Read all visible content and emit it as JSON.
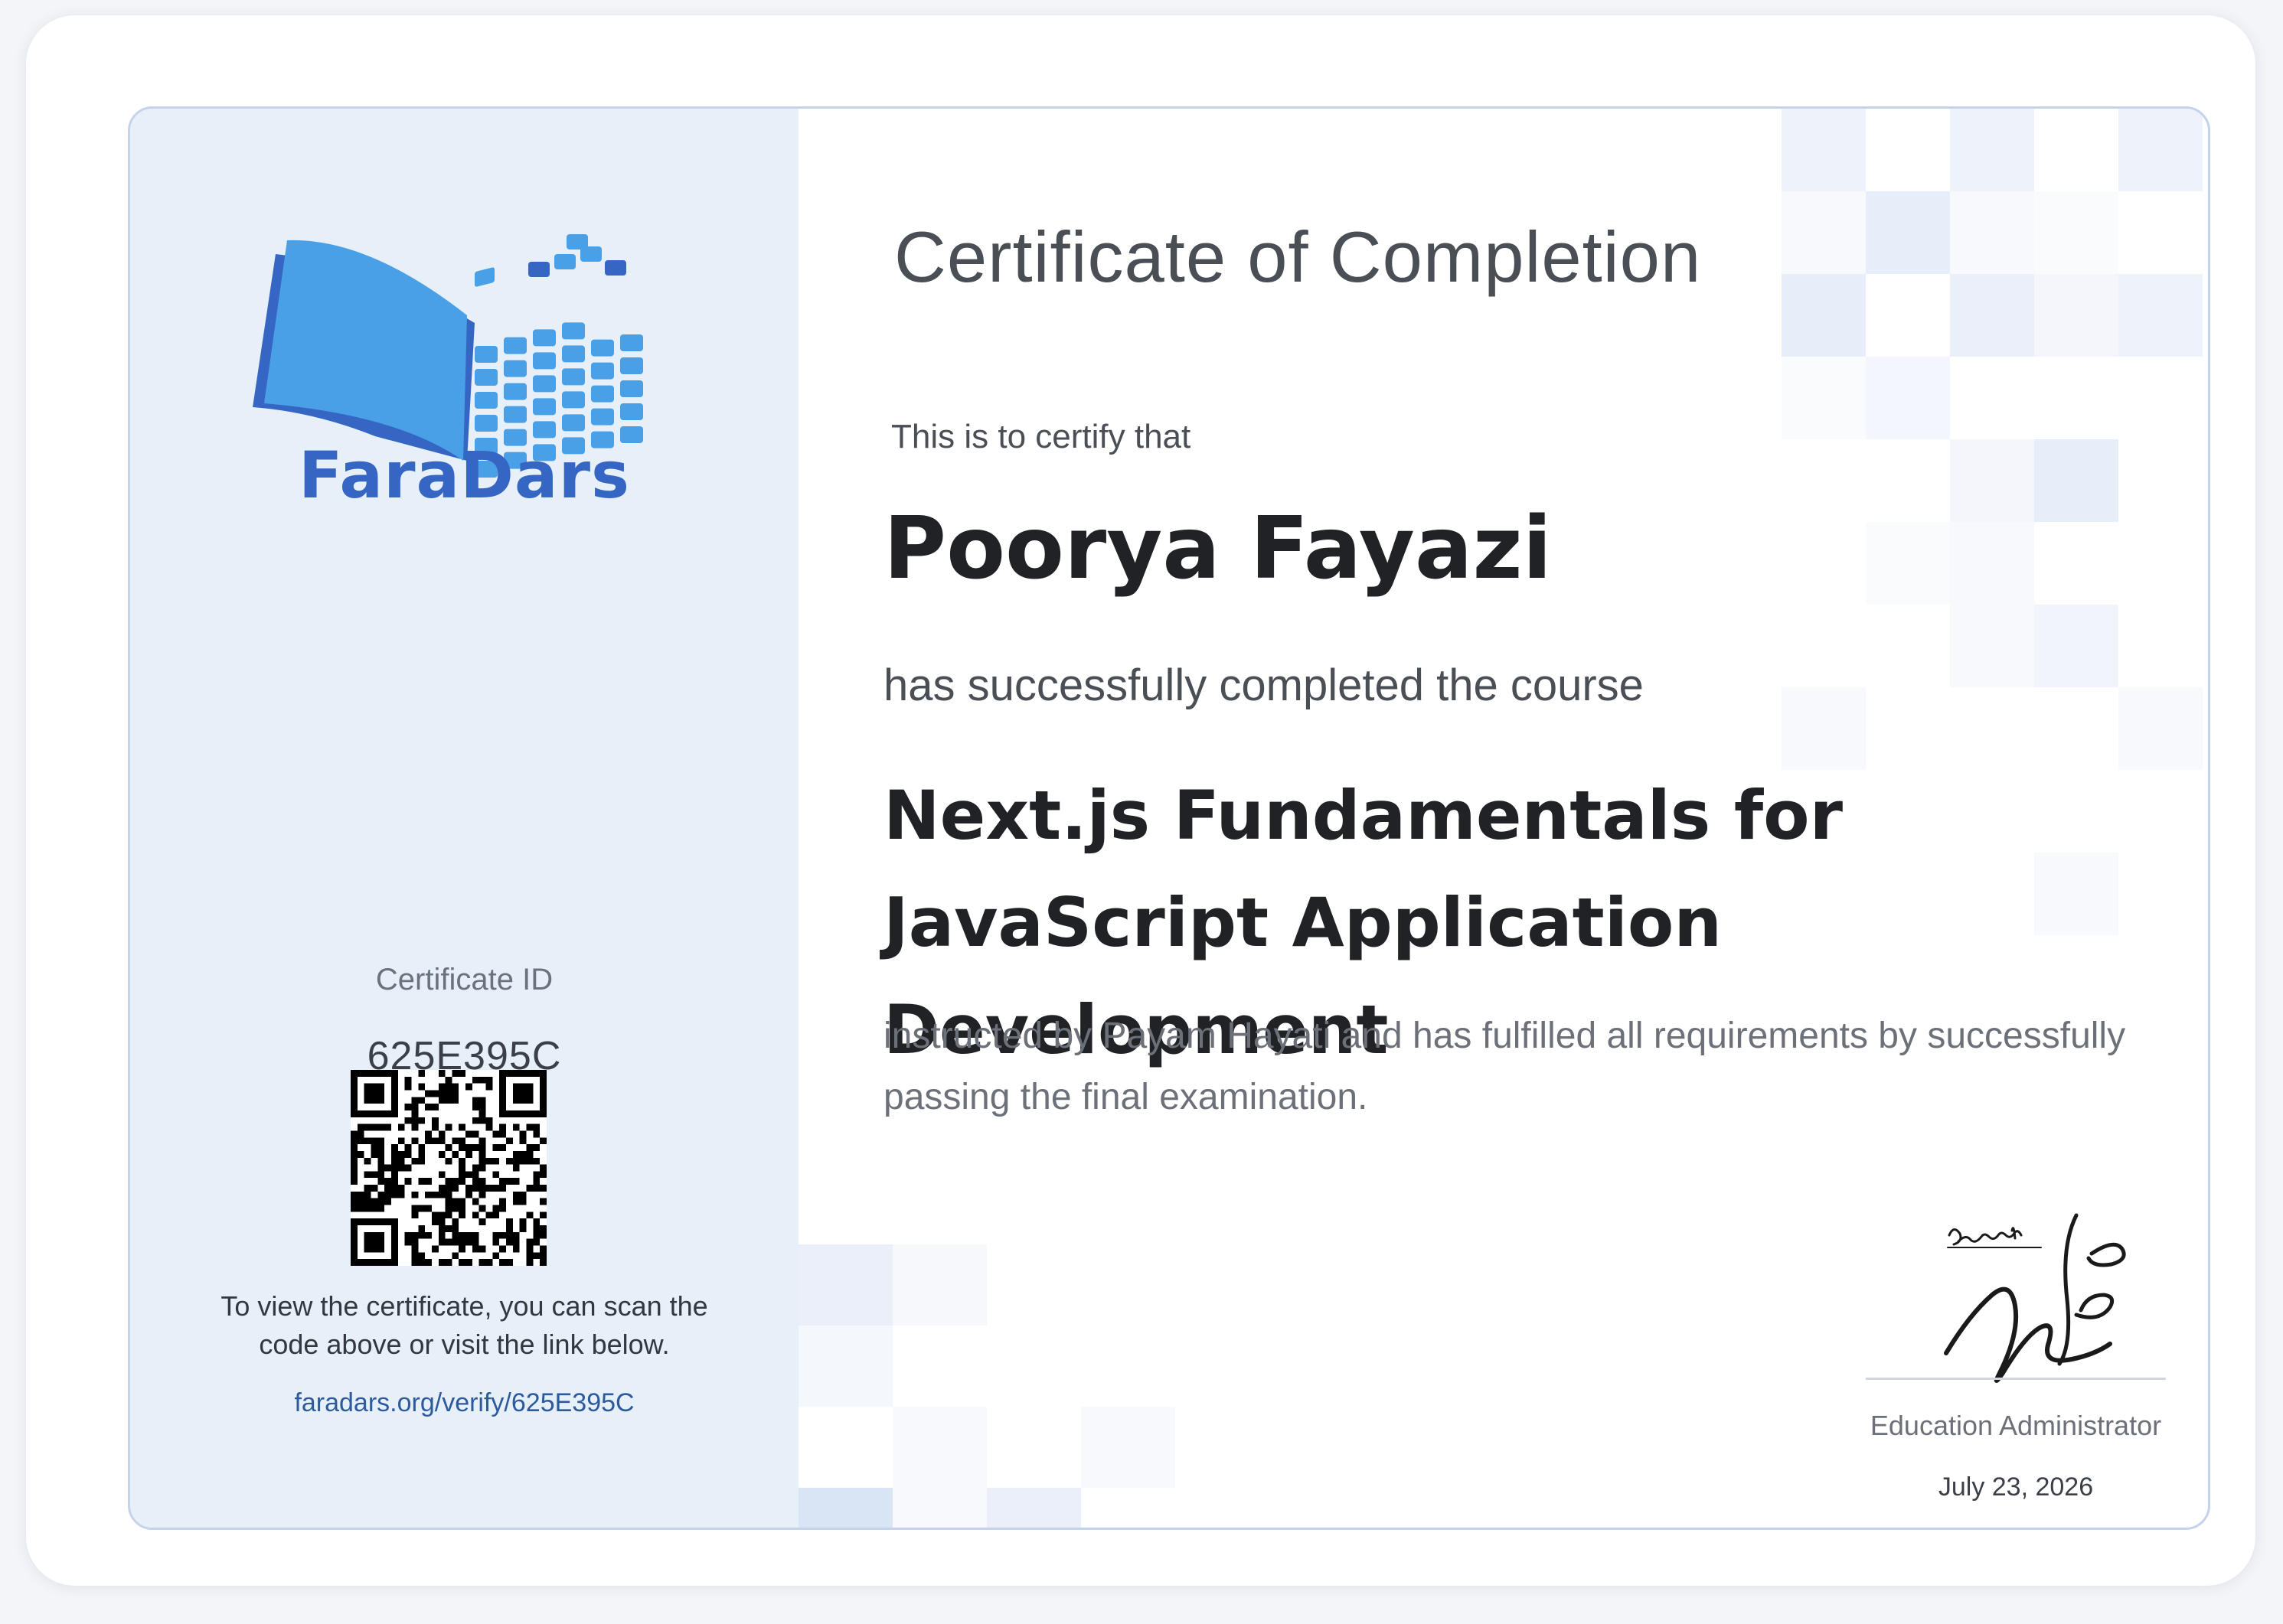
{
  "brand": {
    "name": "FaraDars",
    "primary_color": "#3566c3",
    "accent_color": "#4aa0e6"
  },
  "certificate": {
    "title": "Certificate of Completion",
    "certify_text": "This is to certify that",
    "recipient_name": "Poorya Fayazi",
    "completed_text": "has successfully completed the course",
    "course_name": "Next.js Fundamentals for JavaScript Application Development",
    "instructed_text": "instructed by Payam Hayati and has fulfilled all requirements by successfully passing the final examination."
  },
  "left_panel": {
    "cert_id_label": "Certificate ID",
    "cert_id_value": "625E395C",
    "qr_note": "To view the certificate, you can scan the code above or visit the link below.",
    "verify_link": "faradars.org/verify/625E395C"
  },
  "signature": {
    "role": "Education Administrator",
    "date": "July 23, 2026"
  }
}
